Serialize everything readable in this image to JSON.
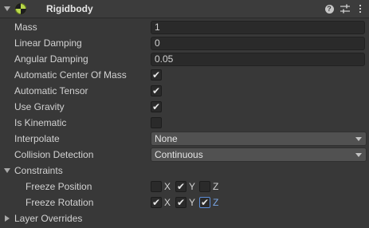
{
  "component": {
    "title": "Rigidbody",
    "enabled": true,
    "expanded": true
  },
  "properties": {
    "mass": {
      "label": "Mass",
      "value": "1"
    },
    "linear_damping": {
      "label": "Linear Damping",
      "value": "0"
    },
    "angular_damping": {
      "label": "Angular Damping",
      "value": "0.05"
    },
    "auto_center_of_mass": {
      "label": "Automatic Center Of Mass",
      "checked": true,
      "mark": "✔"
    },
    "auto_tensor": {
      "label": "Automatic Tensor",
      "checked": true,
      "mark": "✔"
    },
    "use_gravity": {
      "label": "Use Gravity",
      "checked": true,
      "mark": "✔"
    },
    "is_kinematic": {
      "label": "Is Kinematic",
      "checked": false,
      "mark": ""
    },
    "interpolate": {
      "label": "Interpolate",
      "value": "None"
    },
    "collision_detection": {
      "label": "Collision Detection",
      "value": "Continuous"
    }
  },
  "constraints": {
    "label": "Constraints",
    "expanded": true,
    "freeze_position": {
      "label": "Freeze Position",
      "x": {
        "label": "X",
        "checked": false,
        "mark": ""
      },
      "y": {
        "label": "Y",
        "checked": true,
        "mark": "✔"
      },
      "z": {
        "label": "Z",
        "checked": false,
        "mark": ""
      }
    },
    "freeze_rotation": {
      "label": "Freeze Rotation",
      "x": {
        "label": "X",
        "checked": true,
        "mark": "✔"
      },
      "y": {
        "label": "Y",
        "checked": true,
        "mark": "✔"
      },
      "z": {
        "label": "Z",
        "checked": true,
        "mark": "✔"
      }
    }
  },
  "layer_overrides": {
    "label": "Layer Overrides",
    "expanded": false
  },
  "icons": {
    "component": "rigidbody-icon",
    "help": "help-icon",
    "presets": "presets-icon",
    "menu": "kebab-menu-icon",
    "help_glyph": "?"
  },
  "colors": {
    "background": "#383838",
    "header": "#3c3c3c",
    "field": "#2a2a2a",
    "dropdown": "#515151",
    "focus_accent": "#5b8cd6",
    "component_icon": "#b8d84a"
  }
}
